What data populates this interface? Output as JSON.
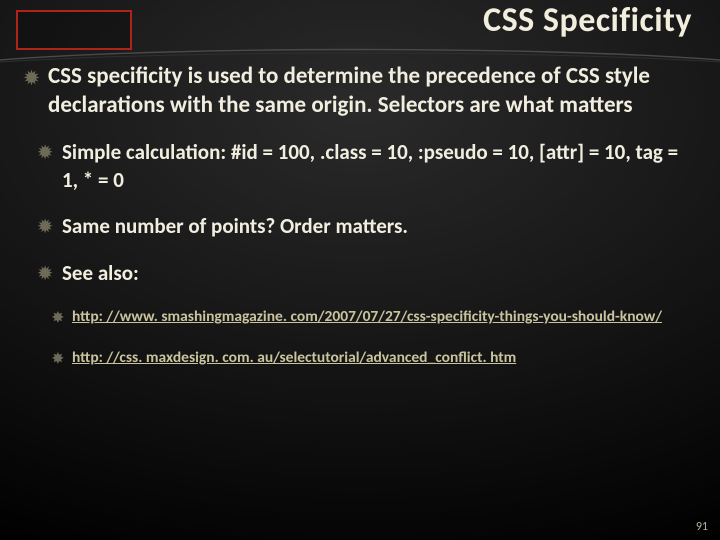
{
  "title": "CSS Specificity",
  "bullets": {
    "main": "CSS specificity is used to determine the precedence of CSS style declarations with the same origin. Selectors are what matters",
    "sub1": "Simple calculation: #id = 100, .class = 10, :pseudo = 10, [attr] = 10, tag = 1, * = 0",
    "sub2": "Same number of points? Order matters.",
    "sub3": "See also:",
    "link1": "http: //www. smashingmagazine. com/2007/07/27/css-specificity-things-you-should-know/",
    "link2": "http: //css. maxdesign. com. au/selectutorial/advanced_conflict. htm"
  },
  "page_number": "91",
  "icons": {
    "burst": "✹",
    "star": "✸"
  }
}
